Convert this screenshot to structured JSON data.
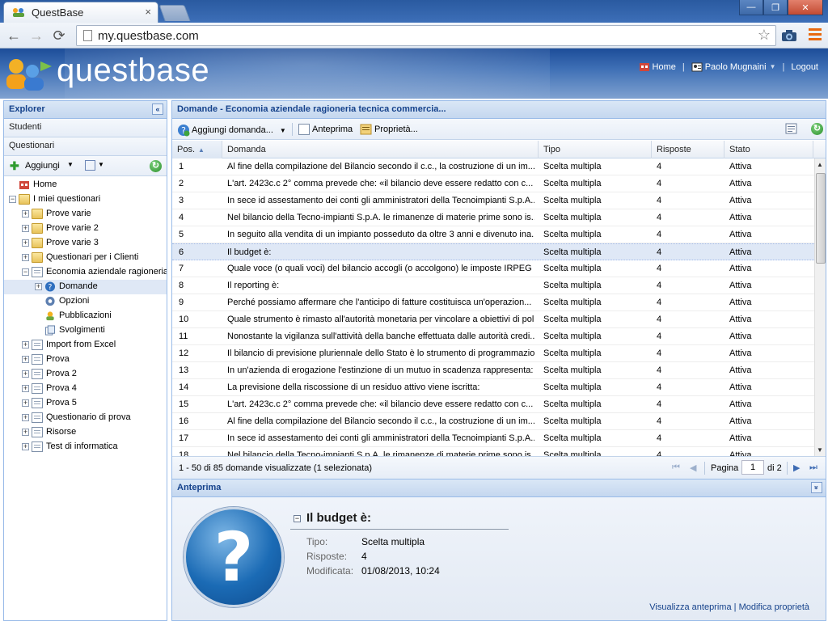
{
  "browser": {
    "tab_title": "QuestBase",
    "tab_close": "×",
    "url": "my.questbase.com",
    "nav_back": "←",
    "nav_forward": "→",
    "nav_reload": "⟳",
    "star": "☆",
    "win_min": "—",
    "win_max": "❐",
    "win_close": "✕"
  },
  "header": {
    "brand": "questbase",
    "home_label": "Home",
    "user_label": "Paolo Mugnaini",
    "logout_label": "Logout",
    "sep": "|"
  },
  "explorer": {
    "title": "Explorer",
    "collapse": "«",
    "accordion": [
      "Studenti",
      "Questionari"
    ],
    "add_label": "Aggiungi",
    "dd": "▼",
    "refresh": "↻",
    "tree": [
      {
        "label": "Home",
        "level": 0,
        "icon": "home",
        "exp": ""
      },
      {
        "label": "I miei questionari",
        "level": 0,
        "icon": "folder",
        "exp": "−"
      },
      {
        "label": "Prove varie",
        "level": 1,
        "icon": "folder",
        "exp": "+"
      },
      {
        "label": "Prove varie 2",
        "level": 1,
        "icon": "folder",
        "exp": "+"
      },
      {
        "label": "Prove varie 3",
        "level": 1,
        "icon": "folder",
        "exp": "+"
      },
      {
        "label": "Questionari per i Clienti",
        "level": 1,
        "icon": "folder",
        "exp": "+"
      },
      {
        "label": "Economia aziendale ragioneria tecnica commerciale",
        "level": 1,
        "icon": "doc",
        "exp": "−"
      },
      {
        "label": "Domande",
        "level": 2,
        "icon": "question",
        "exp": "+",
        "selected": true
      },
      {
        "label": "Opzioni",
        "level": 2,
        "icon": "gear",
        "exp": ""
      },
      {
        "label": "Pubblicazioni",
        "level": 2,
        "icon": "people",
        "exp": ""
      },
      {
        "label": "Svolgimenti",
        "level": 2,
        "icon": "sheets",
        "exp": ""
      },
      {
        "label": "Import from Excel",
        "level": 1,
        "icon": "doc",
        "exp": "+"
      },
      {
        "label": "Prova",
        "level": 1,
        "icon": "doc",
        "exp": "+"
      },
      {
        "label": "Prova 2",
        "level": 1,
        "icon": "doc",
        "exp": "+"
      },
      {
        "label": "Prova 4",
        "level": 1,
        "icon": "doc",
        "exp": "+"
      },
      {
        "label": "Prova 5",
        "level": 1,
        "icon": "doc",
        "exp": "+"
      },
      {
        "label": "Questionario di prova",
        "level": 1,
        "icon": "doc",
        "exp": "+"
      },
      {
        "label": "Risorse",
        "level": 1,
        "icon": "doc",
        "exp": "+"
      },
      {
        "label": "Test di informatica",
        "level": 1,
        "icon": "doc",
        "exp": "+"
      }
    ]
  },
  "main": {
    "title": "Domande - Economia aziendale ragioneria tecnica commercia...",
    "toolbar": {
      "add_question": "Aggiungi domanda...",
      "preview": "Anteprima",
      "properties": "Proprietà..."
    },
    "columns": [
      "Pos.",
      "Domanda",
      "Tipo",
      "Risposte",
      "Stato"
    ],
    "sort_arrow": "▲",
    "rows": [
      {
        "pos": "1",
        "q": "Al fine della compilazione del Bilancio secondo il c.c., la costruzione di un im...",
        "type": "Scelta multipla",
        "ans": "4",
        "state": "Attiva"
      },
      {
        "pos": "2",
        "q": "L'art. 2423c.c 2° comma prevede che: «il bilancio deve essere redatto con c...",
        "type": "Scelta multipla",
        "ans": "4",
        "state": "Attiva"
      },
      {
        "pos": "3",
        "q": "In sece id assestamento dei conti gli amministratori della Tecnoimpianti S.p.A....",
        "type": "Scelta multipla",
        "ans": "4",
        "state": "Attiva"
      },
      {
        "pos": "4",
        "q": "Nel bilancio della Tecno-impianti S.p.A. le rimanenze di materie prime sono is...",
        "type": "Scelta multipla",
        "ans": "4",
        "state": "Attiva"
      },
      {
        "pos": "5",
        "q": "In seguito alla vendita di un impianto posseduto da oltre 3 anni e divenuto ina...",
        "type": "Scelta multipla",
        "ans": "4",
        "state": "Attiva"
      },
      {
        "pos": "6",
        "q": "Il budget è:",
        "type": "Scelta multipla",
        "ans": "4",
        "state": "Attiva",
        "selected": true
      },
      {
        "pos": "7",
        "q": "Quale voce (o quali voci) del bilancio accogli (o accolgono) le imposte IRPEG ...",
        "type": "Scelta multipla",
        "ans": "4",
        "state": "Attiva"
      },
      {
        "pos": "8",
        "q": "Il reporting è:",
        "type": "Scelta multipla",
        "ans": "4",
        "state": "Attiva"
      },
      {
        "pos": "9",
        "q": "Perché possiamo affermare che l'anticipo di fatture costituisca un'operazion...",
        "type": "Scelta multipla",
        "ans": "4",
        "state": "Attiva"
      },
      {
        "pos": "10",
        "q": "Quale strumento è rimasto all'autorità monetaria per vincolare a obiettivi di pol...",
        "type": "Scelta multipla",
        "ans": "4",
        "state": "Attiva"
      },
      {
        "pos": "11",
        "q": "Nonostante la vigilanza sull'attività della banche effettuata dalle autorità credi...",
        "type": "Scelta multipla",
        "ans": "4",
        "state": "Attiva"
      },
      {
        "pos": "12",
        "q": "Il bilancio di previsione pluriennale dello Stato è lo strumento di programmazio...",
        "type": "Scelta multipla",
        "ans": "4",
        "state": "Attiva"
      },
      {
        "pos": "13",
        "q": "In un'azienda di erogazione l'estinzione di un mutuo in scadenza rappresenta:",
        "type": "Scelta multipla",
        "ans": "4",
        "state": "Attiva"
      },
      {
        "pos": "14",
        "q": "La previsione della riscossione di un residuo attivo viene iscritta:",
        "type": "Scelta multipla",
        "ans": "4",
        "state": "Attiva"
      },
      {
        "pos": "15",
        "q": "L'art. 2423c.c 2° comma prevede che: «il bilancio deve essere redatto con c...",
        "type": "Scelta multipla",
        "ans": "4",
        "state": "Attiva"
      },
      {
        "pos": "16",
        "q": "Al fine della compilazione del Bilancio secondo il c.c., la costruzione di un im...",
        "type": "Scelta multipla",
        "ans": "4",
        "state": "Attiva"
      },
      {
        "pos": "17",
        "q": "In sece id assestamento dei conti gli amministratori della Tecnoimpianti S.p.A....",
        "type": "Scelta multipla",
        "ans": "4",
        "state": "Attiva"
      },
      {
        "pos": "18",
        "q": "Nel bilancio della Tecno-impianti S.p.A. le rimanenze di materie prime sono is...",
        "type": "Scelta multipla",
        "ans": "4",
        "state": "Attiva"
      }
    ],
    "paging": {
      "info": "1 - 50 di 85 domande visualizzate (1 selezionata)",
      "page_label": "Pagina",
      "page_value": "1",
      "of_label": "di 2",
      "first": "⏮",
      "prev": "◀",
      "next": "▶",
      "last": "⏭"
    }
  },
  "preview": {
    "title": "Anteprima",
    "collapse": "»",
    "q_title": "Il budget è:",
    "q_mark": "?",
    "type_key": "Tipo:",
    "type_val": "Scelta multipla",
    "ans_key": "Risposte:",
    "ans_val": "4",
    "mod_key": "Modificata:",
    "mod_val": "01/08/2013, 10:24",
    "link_preview": "Visualizza anteprima",
    "link_sep": "|",
    "link_edit": "Modifica proprietà"
  }
}
